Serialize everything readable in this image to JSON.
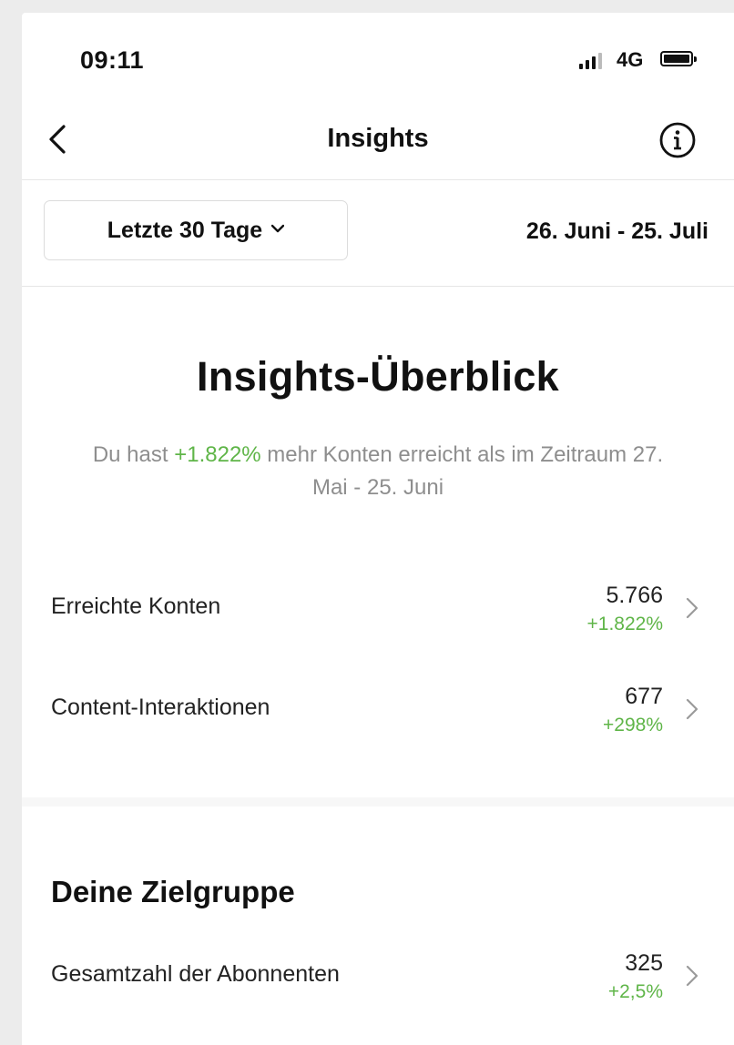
{
  "status_bar": {
    "time": "09:11",
    "network": "4G"
  },
  "nav": {
    "title": "Insights",
    "back_icon": "chevron-left-icon",
    "info_icon": "info-icon"
  },
  "filter": {
    "range_label": "Letzte 30 Tage",
    "date_range": "26. Juni - 25. Juli"
  },
  "overview": {
    "title": "Insights-Überblick",
    "desc_before": "Du hast ",
    "desc_highlight": "+1.822%",
    "desc_after": " mehr Konten erreicht als im Zeitraum 27. Mai - 25. Juni"
  },
  "metrics": [
    {
      "label": "Erreichte Konten",
      "value": "5.766",
      "change": "+1.822%"
    },
    {
      "label": "Content-Interaktionen",
      "value": "677",
      "change": "+298%"
    }
  ],
  "audience": {
    "title": "Deine Zielgruppe",
    "rows": [
      {
        "label": "Gesamtzahl der Abonnenten",
        "value": "325",
        "change": "+2,5%"
      }
    ]
  },
  "colors": {
    "positive": "#5fb548",
    "muted_text": "#8e8e8e",
    "divider": "#e6e6e6"
  }
}
